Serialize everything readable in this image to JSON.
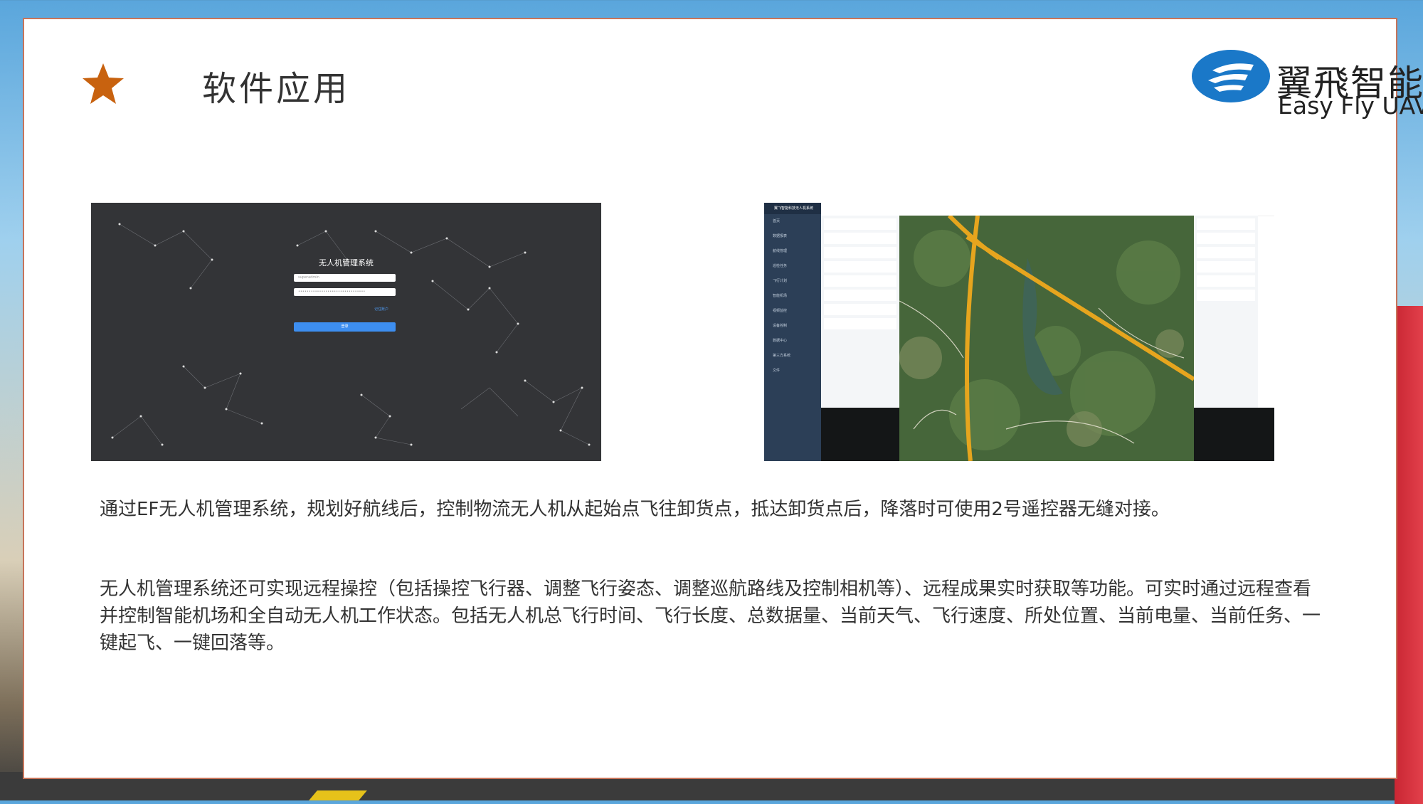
{
  "slide": {
    "title": "软件应用",
    "logo": {
      "cn": "翼飛智能",
      "en": "Easy Fly UAV"
    },
    "paragraphs": [
      "通过EF无人机管理系统，规划好航线后，控制物流无人机从起始点飞往卸货点，抵达卸货点后，降落时可使用2号遥控器无缝对接。",
      "无人机管理系统还可实现远程操控（包括操控飞行器、调整飞行姿态、调整巡航路线及控制相机等）、远程成果实时获取等功能。可实时通过远程查看并控制智能机场和全自动无人机工作状态。包括无人机总飞行时间、飞行长度、总数据量、当前天气、飞行速度、所处位置、当前电量、当前任务、一键起飞、一键回落等。"
    ]
  },
  "login_screenshot": {
    "title": "无人机管理系统",
    "username": "superadmin",
    "remember": "记住账户",
    "button": "登录"
  },
  "dashboard_screenshot": {
    "header": "翼飞智能科技无人机系统",
    "menu": [
      "首页",
      "数据报表",
      "航线管理",
      "巡检任务",
      "飞行计划",
      "智能机场",
      "视频监控",
      "设备控制",
      "数据中心",
      "第三方系统",
      "文件"
    ]
  },
  "colors": {
    "accent": "#c8620f",
    "frame": "#c7745a",
    "logo_blue": "#1a78c8"
  }
}
